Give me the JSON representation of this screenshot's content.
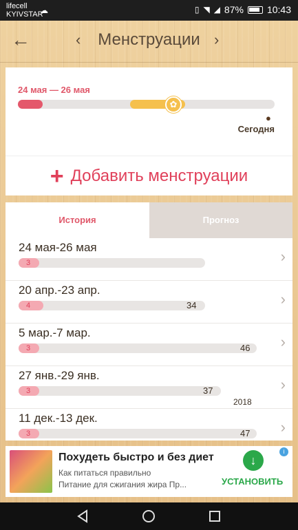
{
  "status_bar": {
    "carrier1": "lifecell",
    "carrier2": "KYIVSTAR",
    "battery": "87%",
    "time": "10:43"
  },
  "header": {
    "title": "Менструации"
  },
  "period_card": {
    "range": "24 мая — 26 мая",
    "today_label": "Сегодня",
    "add_label": "Добавить менструации"
  },
  "tabs": {
    "history": "История",
    "forecast": "Прогноз"
  },
  "history": [
    {
      "date": "24 мая-26 мая",
      "length": "3",
      "cycle": "",
      "year": ""
    },
    {
      "date": "20 апр.-23 апр.",
      "length": "4",
      "cycle": "34",
      "year": ""
    },
    {
      "date": "5 мар.-7 мар.",
      "length": "3",
      "cycle": "46",
      "year": ""
    },
    {
      "date": "27 янв.-29 янв.",
      "length": "3",
      "cycle": "37",
      "year": "2018"
    },
    {
      "date": "11 дек.-13 дек.",
      "length": "3",
      "cycle": "47",
      "year": ""
    }
  ],
  "ad": {
    "title": "Похудеть быстро и без диет",
    "line1": "Как питаться правильно",
    "line2": "Питание для сжигания жира Пр...",
    "install": "УСТАНОВИТЬ"
  },
  "colors": {
    "accent": "#e0405a",
    "ovulation": "#f5c04d",
    "wood": "#e9c892"
  }
}
